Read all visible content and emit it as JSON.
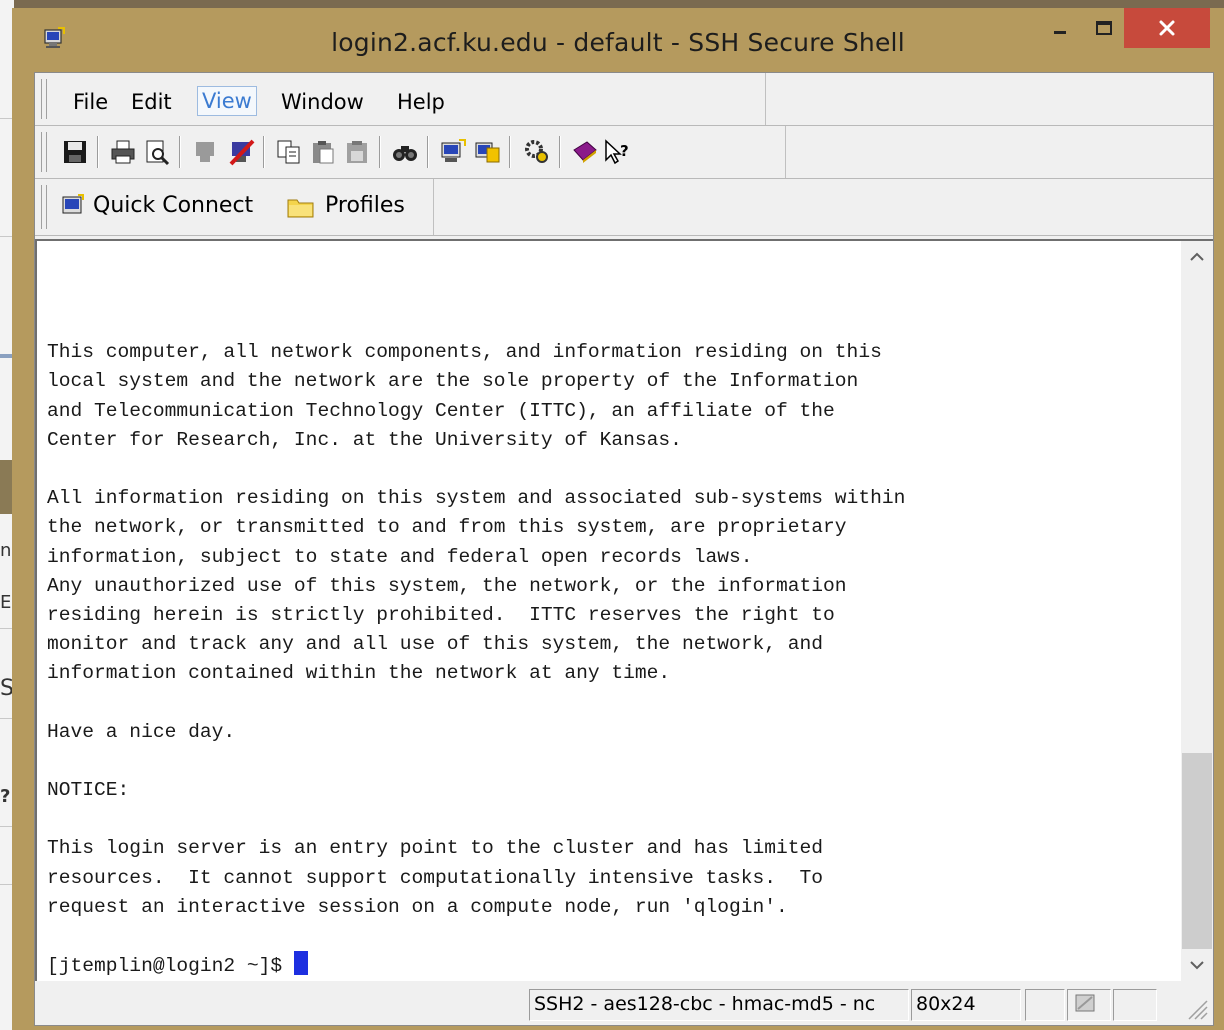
{
  "window": {
    "title": "login2.acf.ku.edu - default - SSH Secure Shell",
    "accent_close": "#c74a3c",
    "frame_color": "#b59a5e"
  },
  "menu": {
    "items": [
      "File",
      "Edit",
      "View",
      "Window",
      "Help"
    ],
    "active": "View"
  },
  "toolbar": {
    "icons": [
      "save-icon",
      "print-icon",
      "print-preview-icon",
      "disconnect-icon",
      "disconnect-red-icon",
      "copy-icon",
      "paste-icon",
      "paste-disabled-icon",
      "find-icon",
      "new-terminal-icon",
      "new-file-transfer-icon",
      "settings-icon",
      "help-book-icon",
      "whats-this-icon"
    ]
  },
  "connectbar": {
    "quick_connect": "Quick Connect",
    "profiles": "Profiles"
  },
  "terminal": {
    "lines": [
      "",
      "This computer, all network components, and information residing on this",
      "local system and the network are the sole property of the Information",
      "and Telecommunication Technology Center (ITTC), an affiliate of the",
      "Center for Research, Inc. at the University of Kansas.",
      "",
      "All information residing on this system and associated sub-systems within",
      "the network, or transmitted to and from this system, are proprietary",
      "information, subject to state and federal open records laws.",
      "Any unauthorized use of this system, the network, or the information",
      "residing herein is strictly prohibited.  ITTC reserves the right to",
      "monitor and track any and all use of this system, the network, and",
      "information contained within the network at any time.",
      "",
      "Have a nice day.",
      "",
      "NOTICE:",
      "",
      "This login server is an entry point to the cluster and has limited",
      "resources.  It cannot support computationally intensive tasks.  To",
      "request an interactive session on a compute node, run 'qlogin'.",
      ""
    ],
    "prompt": "[jtemplin@login2 ~]$ ",
    "cursor_color": "#1d2fe0"
  },
  "statusbar": {
    "connection": "SSH2 - aes128-cbc - hmac-md5 - nc",
    "size": "80x24"
  },
  "background": {
    "partial_glyphs": [
      "n",
      "E",
      "S",
      "?"
    ]
  }
}
